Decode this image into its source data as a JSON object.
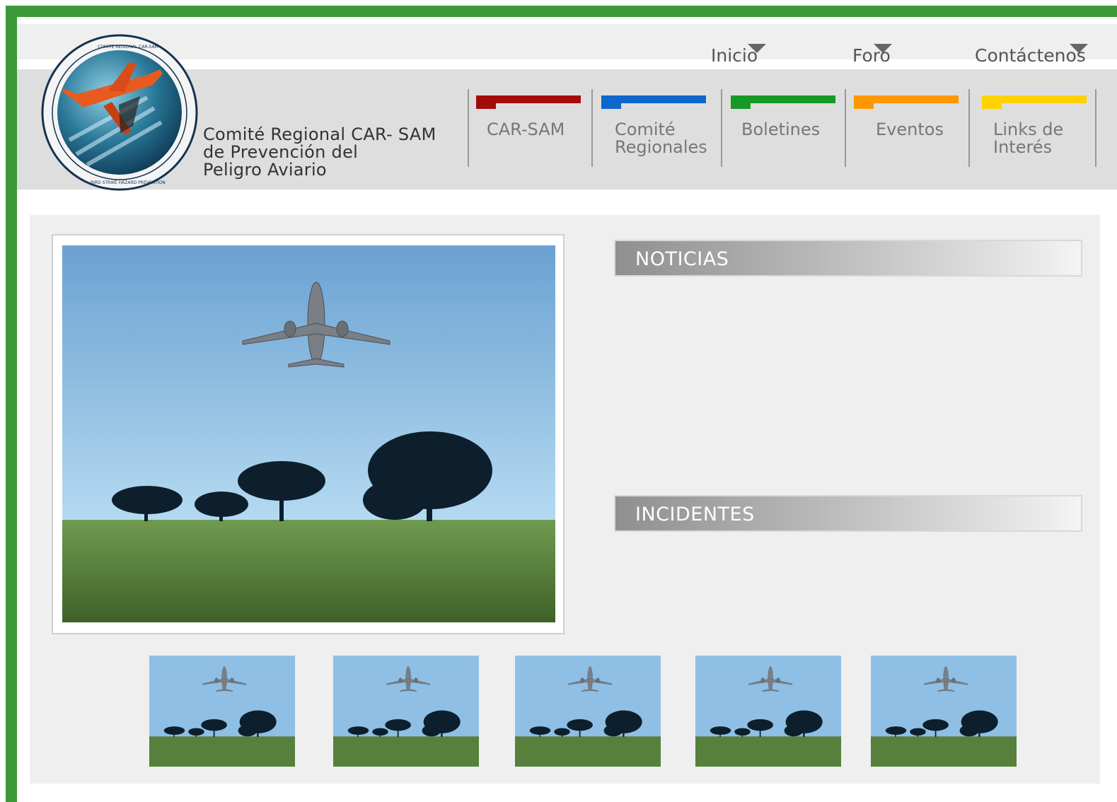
{
  "top_nav": {
    "items": [
      {
        "label": "Inicio"
      },
      {
        "label": "Foro"
      },
      {
        "label": "Contáctenos"
      }
    ]
  },
  "org": {
    "name_lines": [
      "Comité Regional CAR- SAM",
      "de Prevención del",
      "Peligro Aviario"
    ]
  },
  "main_nav": {
    "items": [
      {
        "lines": [
          "CAR-SAM"
        ],
        "color": "#a30b0b"
      },
      {
        "lines": [
          "Comité",
          "Regionales"
        ],
        "color": "#0f66cc"
      },
      {
        "lines": [
          "Boletines"
        ],
        "color": "#169a25"
      },
      {
        "lines": [
          "Eventos"
        ],
        "color": "#ff9700"
      },
      {
        "lines": [
          "Links de",
          "Interés"
        ],
        "color": "#ffd200"
      }
    ]
  },
  "sections": {
    "noticias": {
      "title": "NOTICIAS"
    },
    "incidentes": {
      "title": "INCIDENTES"
    }
  },
  "gallery": {
    "thumbnail_count": 5
  },
  "colors": {
    "frame_green": "#3a9a35",
    "header_gray": "#dedede",
    "content_gray": "#efefef"
  }
}
